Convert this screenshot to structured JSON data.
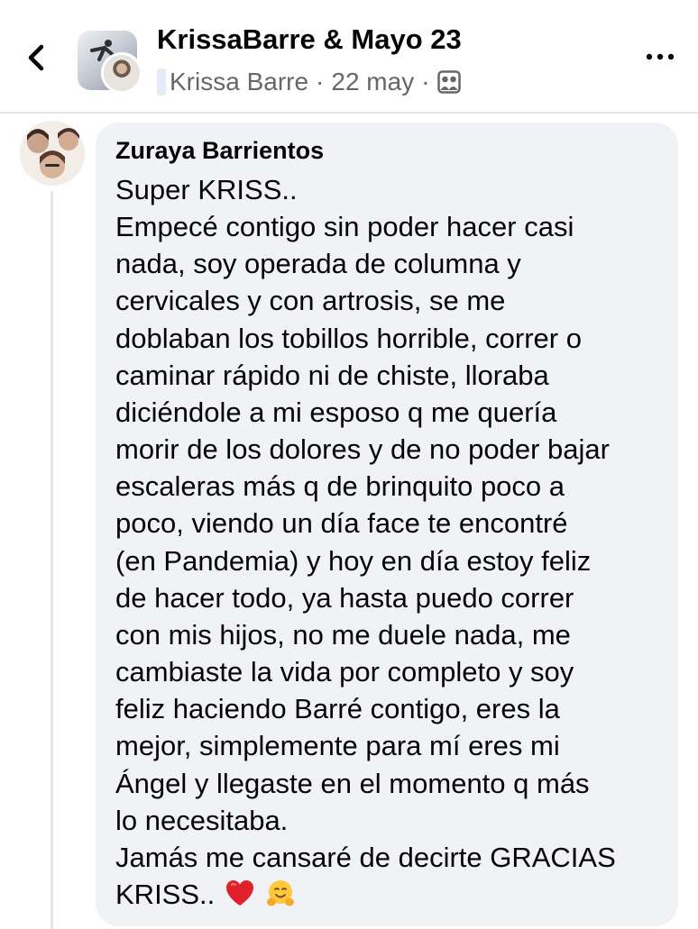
{
  "header": {
    "title": "KrissaBarre & Mayo 23",
    "author": "Krissa Barre",
    "separator": "·",
    "date": "22 may"
  },
  "comment": {
    "author": "Zuraya Barrientos",
    "lines": [
      "Super KRISS..",
      "Empecé contigo sin poder hacer casi",
      "nada, soy operada de columna y",
      "cervicales y con artrosis, se me",
      "doblaban los tobillos horrible, correr o",
      "caminar rápido ni de chiste, lloraba",
      "diciéndole a mi esposo q me quería",
      "morir de los dolores y de no poder bajar",
      "escaleras más q de brinquito poco a",
      "poco, viendo un día face te encontré",
      "(en Pandemia) y hoy en día estoy feliz",
      "de hacer todo, ya hasta puedo correr",
      "con mis hijos, no me duele nada, me",
      "cambiaste la vida por completo y soy",
      "feliz haciendo Barré contigo, eres la",
      "mejor, simplemente para mí eres mi",
      "Ángel y llegaste en el momento q más",
      "lo necesitaba.",
      "Jamás me cansaré de decirte GRACIAS",
      "KRISS.."
    ],
    "emojis": [
      "red-heart",
      "hugging-face"
    ]
  },
  "colors": {
    "text_primary": "#050505",
    "text_secondary": "#65676b",
    "bubble_bg": "#f0f2f5",
    "divider": "#e4e6eb",
    "heart": "#e0202a",
    "hug_face": "#ffc83d"
  }
}
